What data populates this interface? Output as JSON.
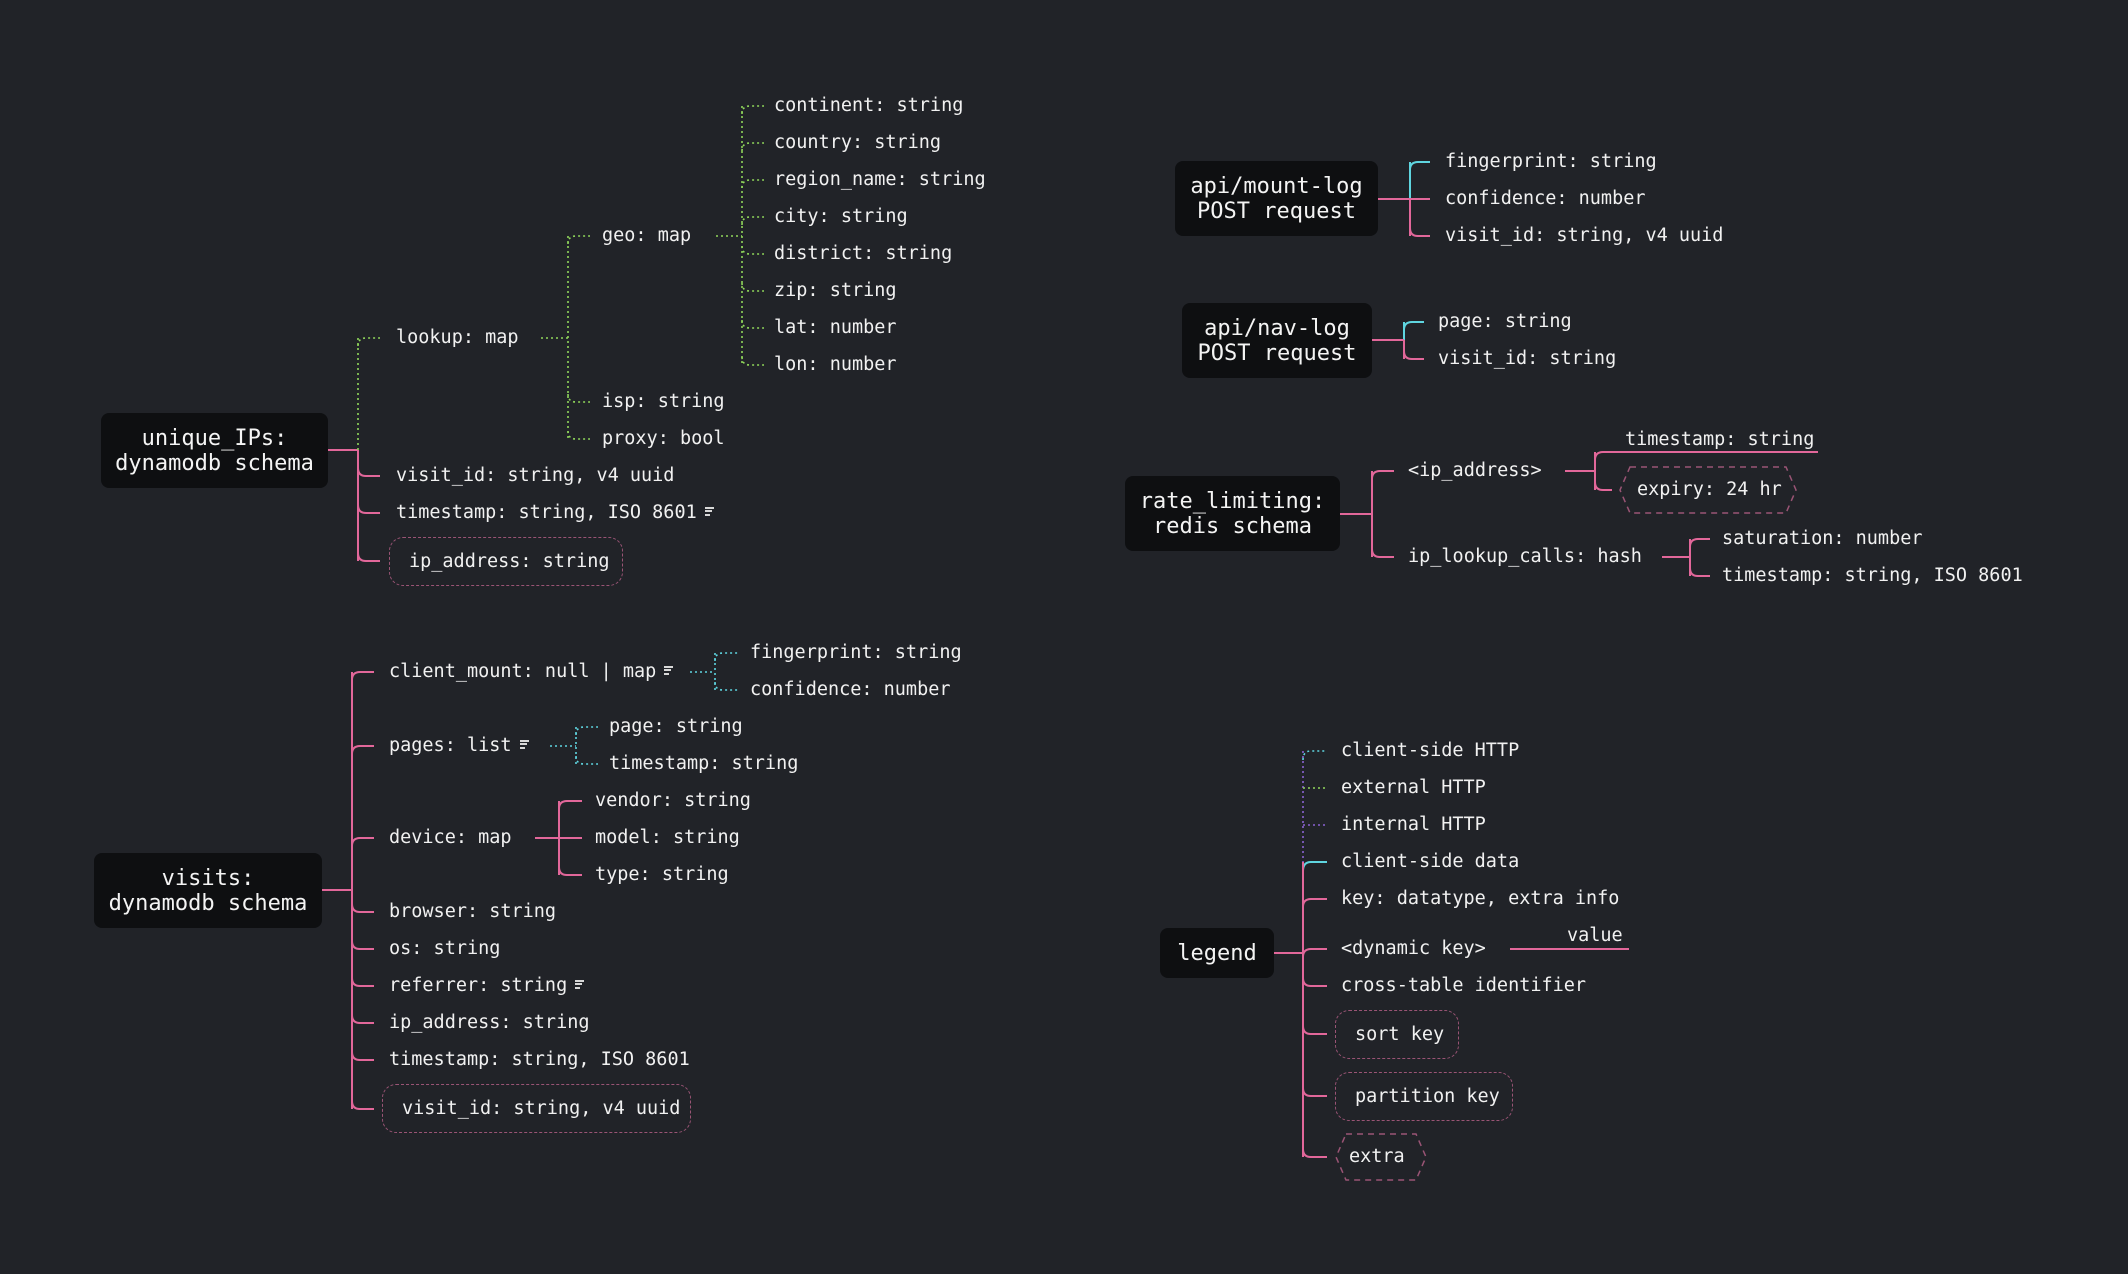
{
  "colors": {
    "pink": "#e2679a",
    "green": "#8fd65a",
    "cyan": "#5fd5e0",
    "purple": "#8a63d2",
    "node_bg": "#0e0f11",
    "bg": "#212328"
  },
  "unique_ips": {
    "title": "unique_IPs:\ndynamodb schema",
    "lookup": "lookup: map",
    "geo": "geo: map",
    "geo_fields": [
      "continent: string",
      "country: string",
      "region_name: string",
      "city: string",
      "district: string",
      "zip: string",
      "lat: number",
      "lon: number"
    ],
    "isp": "isp: string",
    "proxy": "proxy: bool",
    "visit_id": "visit_id: string, v4 uuid",
    "timestamp": "timestamp: string, ISO 8601",
    "ip_address": "ip_address: string"
  },
  "visits": {
    "title": "visits:\ndynamodb schema",
    "client_mount": "client_mount: null | map",
    "client_mount_fields": [
      "fingerprint: string",
      "confidence: number"
    ],
    "pages": "pages: list",
    "pages_fields": [
      "page: string",
      "timestamp: string"
    ],
    "device": "device: map",
    "device_fields": [
      "vendor: string",
      "model: string",
      "type: string"
    ],
    "browser": "browser: string",
    "os": "os: string",
    "referrer": "referrer: string",
    "ip_address": "ip_address: string",
    "timestamp": "timestamp: string, ISO 8601",
    "visit_id": "visit_id: string, v4 uuid"
  },
  "mount_log": {
    "title": "api/mount-log\nPOST request",
    "fields": [
      "fingerprint: string",
      "confidence: number",
      "visit_id: string, v4 uuid"
    ]
  },
  "nav_log": {
    "title": "api/nav-log\nPOST request",
    "fields": [
      "page: string",
      "visit_id: string"
    ]
  },
  "rate_limiting": {
    "title": "rate_limiting:\nredis schema",
    "ip_address": "<ip_address>",
    "timestamp_value": "timestamp: string",
    "expiry": "expiry: 24 hr",
    "ip_lookup_calls": "ip_lookup_calls: hash",
    "hash_fields": [
      "saturation: number",
      "timestamp: string, ISO 8601"
    ]
  },
  "legend": {
    "title": "legend",
    "client_side_http": "client-side HTTP",
    "external_http": "external HTTP",
    "internal_http": "internal HTTP",
    "client_side_data": "client-side data",
    "key_format": "key: datatype, extra info",
    "dynamic_key": "<dynamic key>",
    "value": "value",
    "cross_table": "cross-table identifier",
    "sort_key": "sort key",
    "partition_key": "partition key",
    "extra": "extra"
  }
}
